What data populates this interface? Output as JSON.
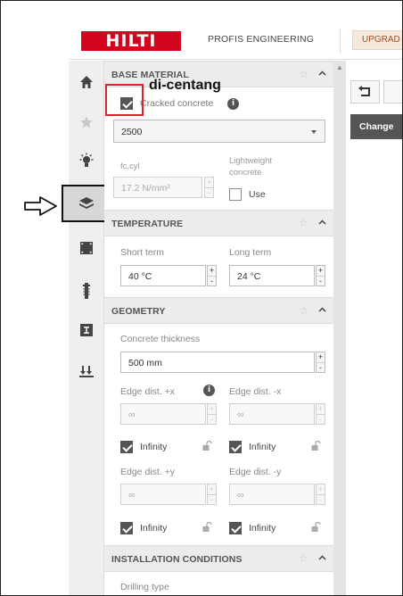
{
  "header": {
    "logo_text": "HILTI",
    "app_name": "PROFIS ENGINEERING",
    "upgrade_label": "UPGRAD"
  },
  "annotation": {
    "text": "di-centang"
  },
  "sidebar": {
    "items": [
      {
        "icon": "home-icon"
      },
      {
        "icon": "star-icon"
      },
      {
        "icon": "lightbulb-icon"
      },
      {
        "icon": "base-material-layers-icon",
        "active": true
      },
      {
        "icon": "square-frame-icon"
      },
      {
        "icon": "anchor-icon"
      },
      {
        "icon": "profile-icon"
      },
      {
        "icon": "loads-icon"
      }
    ]
  },
  "base_material": {
    "title": "BASE MATERIAL",
    "cracked_label": "Cracked concrete",
    "cracked_checked": true,
    "grade_value": "2500",
    "fc_label": "fc,cyl",
    "fc_value": "17.2 N/mm²",
    "lightweight_label": "Lightweight concrete",
    "use_label": "Use"
  },
  "temperature": {
    "title": "TEMPERATURE",
    "short_label": "Short term",
    "short_value": "40 °C",
    "long_label": "Long term",
    "long_value": "24 °C"
  },
  "geometry": {
    "title": "GEOMETRY",
    "thickness_label": "Concrete thickness",
    "thickness_value": "500 mm",
    "edge_px_label": "Edge dist. +x",
    "edge_mx_label": "Edge dist. -x",
    "edge_py_label": "Edge dist. +y",
    "edge_my_label": "Edge dist. -y",
    "edge_value": "∞",
    "infinity_label": "Infinity"
  },
  "installation": {
    "title": "INSTALLATION CONDITIONS",
    "drilling_label": "Drilling type"
  },
  "right_panel": {
    "change_label": "Change"
  },
  "colors": {
    "brand": "#d2051e",
    "highlight": "#e0202b",
    "checkbox": "#555555"
  }
}
